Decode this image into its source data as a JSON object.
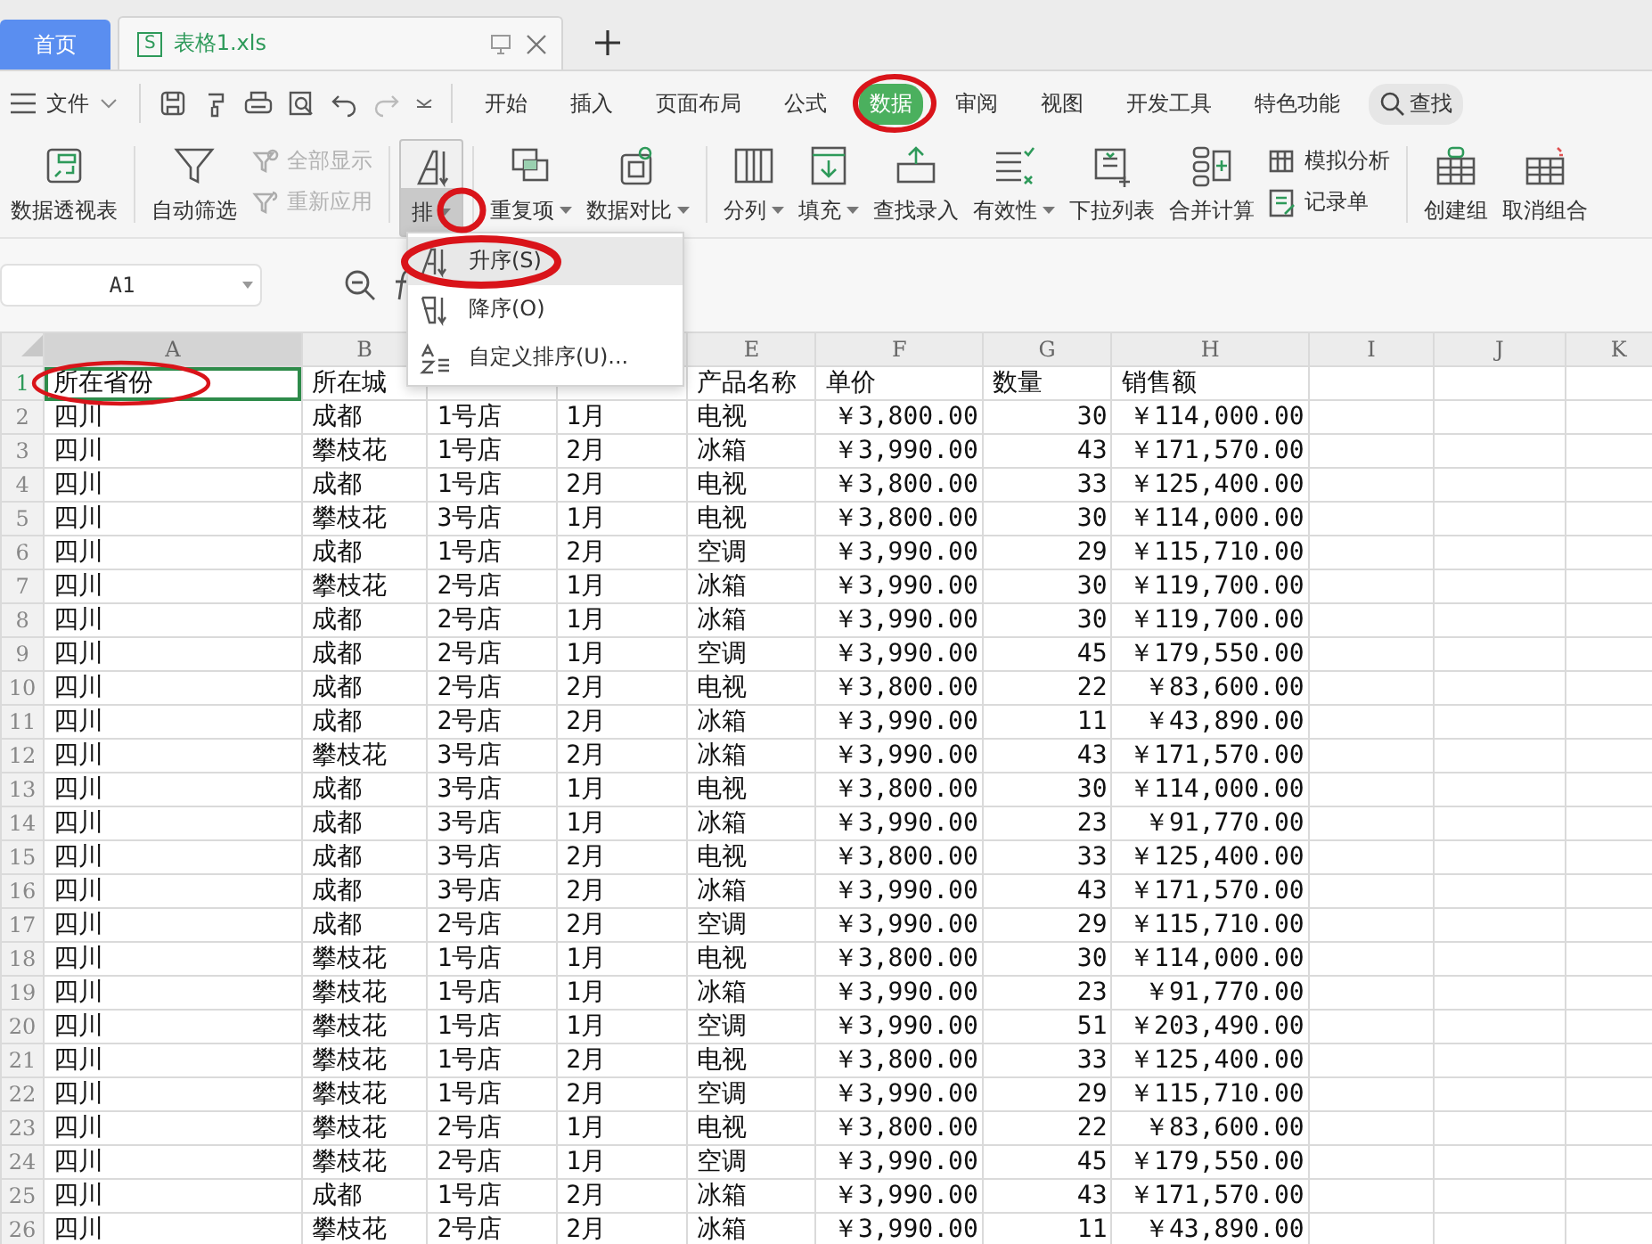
{
  "tabs": [
    {
      "label": "首页",
      "kind": "home",
      "selected": false
    },
    {
      "label": "表格1.xls",
      "kind": "document",
      "badge": "S",
      "selected": true
    }
  ],
  "quick_bar": {
    "file_menu": "文件"
  },
  "menu_tabs": [
    {
      "label": "开始",
      "selected": false
    },
    {
      "label": "插入",
      "selected": false
    },
    {
      "label": "页面布局",
      "selected": false
    },
    {
      "label": "公式",
      "selected": false
    },
    {
      "label": "数据",
      "selected": true
    },
    {
      "label": "审阅",
      "selected": false
    },
    {
      "label": "视图",
      "selected": false
    },
    {
      "label": "开发工具",
      "selected": false
    },
    {
      "label": "特色功能",
      "selected": false
    }
  ],
  "search": {
    "label": "查找"
  },
  "ribbon": {
    "groups": [
      [
        {
          "kind": "large",
          "label": "数据透视表",
          "dropdown": false,
          "pressed": false
        }
      ],
      [
        {
          "kind": "large",
          "label": "自动筛选",
          "dropdown": false,
          "pressed": false
        },
        {
          "kind": "stack",
          "items": [
            {
              "label": "全部显示",
              "disabled": true
            },
            {
              "label": "重新应用",
              "disabled": true
            }
          ]
        }
      ],
      [
        {
          "kind": "large",
          "label": "排",
          "dropdown": true,
          "pressed": true
        }
      ],
      [
        {
          "kind": "large",
          "label": "重复项",
          "dropdown": true,
          "pressed": false
        },
        {
          "kind": "large",
          "label": "数据对比",
          "dropdown": true,
          "pressed": false
        }
      ],
      [
        {
          "kind": "large",
          "label": "分列",
          "dropdown": true,
          "pressed": false
        },
        {
          "kind": "large",
          "label": "填充",
          "dropdown": true,
          "pressed": false
        },
        {
          "kind": "large",
          "label": "查找录入",
          "dropdown": false,
          "pressed": false
        },
        {
          "kind": "large",
          "label": "有效性",
          "dropdown": true,
          "pressed": false
        },
        {
          "kind": "large",
          "label": "下拉列表",
          "dropdown": false,
          "pressed": false
        },
        {
          "kind": "large",
          "label": "合并计算",
          "dropdown": false,
          "pressed": false
        },
        {
          "kind": "stack",
          "items": [
            {
              "label": "模拟分析",
              "disabled": false
            },
            {
              "label": "记录单",
              "disabled": false
            }
          ]
        }
      ],
      [
        {
          "kind": "large",
          "label": "创建组",
          "dropdown": false,
          "pressed": false
        },
        {
          "kind": "large",
          "label": "取消组合",
          "dropdown": false,
          "pressed": false
        }
      ]
    ]
  },
  "sort_menu": [
    {
      "label": "升序(S)",
      "selected": true
    },
    {
      "label": "降序(O)",
      "selected": false
    },
    {
      "label": "自定义排序(U)...",
      "selected": false
    }
  ],
  "name_box": "A1",
  "columns": [
    {
      "label": "A",
      "selected": true,
      "kind": "text"
    },
    {
      "label": "B",
      "selected": false,
      "kind": "text"
    },
    {
      "kind": "text"
    },
    {
      "kind": "text"
    },
    {
      "label": "E",
      "selected": false,
      "kind": "text"
    },
    {
      "label": "F",
      "selected": false,
      "kind": "number"
    },
    {
      "label": "G",
      "selected": false,
      "kind": "number"
    },
    {
      "label": "H",
      "selected": false,
      "kind": "number"
    },
    {
      "label": "I",
      "selected": false,
      "kind": "text"
    },
    {
      "label": "J",
      "selected": false,
      "kind": "text"
    },
    {
      "label": "K",
      "selected": false,
      "kind": "text"
    }
  ],
  "rows": [
    {
      "number": "1",
      "kind": "header",
      "selected": true,
      "cells": [
        "所在省份",
        "所在城",
        null,
        null,
        "产品名称",
        "单价",
        "数量",
        "销售额"
      ]
    },
    {
      "number": "2",
      "kind": "data",
      "selected": false,
      "cells": [
        "四川",
        "成都",
        "1号店",
        "1月",
        "电视",
        "￥3,800.00",
        "30",
        "￥114,000.00"
      ]
    },
    {
      "number": "3",
      "kind": "data",
      "selected": false,
      "cells": [
        "四川",
        "攀枝花",
        "1号店",
        "2月",
        "冰箱",
        "￥3,990.00",
        "43",
        "￥171,570.00"
      ]
    },
    {
      "number": "4",
      "kind": "data",
      "selected": false,
      "cells": [
        "四川",
        "成都",
        "1号店",
        "2月",
        "电视",
        "￥3,800.00",
        "33",
        "￥125,400.00"
      ]
    },
    {
      "number": "5",
      "kind": "data",
      "selected": false,
      "cells": [
        "四川",
        "攀枝花",
        "3号店",
        "1月",
        "电视",
        "￥3,800.00",
        "30",
        "￥114,000.00"
      ]
    },
    {
      "number": "6",
      "kind": "data",
      "selected": false,
      "cells": [
        "四川",
        "成都",
        "1号店",
        "2月",
        "空调",
        "￥3,990.00",
        "29",
        "￥115,710.00"
      ]
    },
    {
      "number": "7",
      "kind": "data",
      "selected": false,
      "cells": [
        "四川",
        "攀枝花",
        "2号店",
        "1月",
        "冰箱",
        "￥3,990.00",
        "30",
        "￥119,700.00"
      ]
    },
    {
      "number": "8",
      "kind": "data",
      "selected": false,
      "cells": [
        "四川",
        "成都",
        "2号店",
        "1月",
        "冰箱",
        "￥3,990.00",
        "30",
        "￥119,700.00"
      ]
    },
    {
      "number": "9",
      "kind": "data",
      "selected": false,
      "cells": [
        "四川",
        "成都",
        "2号店",
        "1月",
        "空调",
        "￥3,990.00",
        "45",
        "￥179,550.00"
      ]
    },
    {
      "number": "10",
      "kind": "data",
      "selected": false,
      "cells": [
        "四川",
        "成都",
        "2号店",
        "2月",
        "电视",
        "￥3,800.00",
        "22",
        "￥83,600.00"
      ]
    },
    {
      "number": "11",
      "kind": "data",
      "selected": false,
      "cells": [
        "四川",
        "成都",
        "2号店",
        "2月",
        "冰箱",
        "￥3,990.00",
        "11",
        "￥43,890.00"
      ]
    },
    {
      "number": "12",
      "kind": "data",
      "selected": false,
      "cells": [
        "四川",
        "攀枝花",
        "3号店",
        "2月",
        "冰箱",
        "￥3,990.00",
        "43",
        "￥171,570.00"
      ]
    },
    {
      "number": "13",
      "kind": "data",
      "selected": false,
      "cells": [
        "四川",
        "成都",
        "3号店",
        "1月",
        "电视",
        "￥3,800.00",
        "30",
        "￥114,000.00"
      ]
    },
    {
      "number": "14",
      "kind": "data",
      "selected": false,
      "cells": [
        "四川",
        "成都",
        "3号店",
        "1月",
        "冰箱",
        "￥3,990.00",
        "23",
        "￥91,770.00"
      ]
    },
    {
      "number": "15",
      "kind": "data",
      "selected": false,
      "cells": [
        "四川",
        "成都",
        "3号店",
        "2月",
        "电视",
        "￥3,800.00",
        "33",
        "￥125,400.00"
      ]
    },
    {
      "number": "16",
      "kind": "data",
      "selected": false,
      "cells": [
        "四川",
        "成都",
        "3号店",
        "2月",
        "冰箱",
        "￥3,990.00",
        "43",
        "￥171,570.00"
      ]
    },
    {
      "number": "17",
      "kind": "data",
      "selected": false,
      "cells": [
        "四川",
        "成都",
        "2号店",
        "2月",
        "空调",
        "￥3,990.00",
        "29",
        "￥115,710.00"
      ]
    },
    {
      "number": "18",
      "kind": "data",
      "selected": false,
      "cells": [
        "四川",
        "攀枝花",
        "1号店",
        "1月",
        "电视",
        "￥3,800.00",
        "30",
        "￥114,000.00"
      ]
    },
    {
      "number": "19",
      "kind": "data",
      "selected": false,
      "cells": [
        "四川",
        "攀枝花",
        "1号店",
        "1月",
        "冰箱",
        "￥3,990.00",
        "23",
        "￥91,770.00"
      ]
    },
    {
      "number": "20",
      "kind": "data",
      "selected": false,
      "cells": [
        "四川",
        "攀枝花",
        "1号店",
        "1月",
        "空调",
        "￥3,990.00",
        "51",
        "￥203,490.00"
      ]
    },
    {
      "number": "21",
      "kind": "data",
      "selected": false,
      "cells": [
        "四川",
        "攀枝花",
        "1号店",
        "2月",
        "电视",
        "￥3,800.00",
        "33",
        "￥125,400.00"
      ]
    },
    {
      "number": "22",
      "kind": "data",
      "selected": false,
      "cells": [
        "四川",
        "攀枝花",
        "1号店",
        "2月",
        "空调",
        "￥3,990.00",
        "29",
        "￥115,710.00"
      ]
    },
    {
      "number": "23",
      "kind": "data",
      "selected": false,
      "cells": [
        "四川",
        "攀枝花",
        "2号店",
        "1月",
        "电视",
        "￥3,800.00",
        "22",
        "￥83,600.00"
      ]
    },
    {
      "number": "24",
      "kind": "data",
      "selected": false,
      "cells": [
        "四川",
        "攀枝花",
        "2号店",
        "1月",
        "空调",
        "￥3,990.00",
        "45",
        "￥179,550.00"
      ]
    },
    {
      "number": "25",
      "kind": "data",
      "selected": false,
      "cells": [
        "四川",
        "成都",
        "1号店",
        "2月",
        "冰箱",
        "￥3,990.00",
        "43",
        "￥171,570.00"
      ]
    },
    {
      "number": "26",
      "kind": "data",
      "selected": false,
      "cells": [
        "四川",
        "攀枝花",
        "2号店",
        "2月",
        "冰箱",
        "￥3,990.00",
        "11",
        "￥43,890.00"
      ]
    }
  ]
}
